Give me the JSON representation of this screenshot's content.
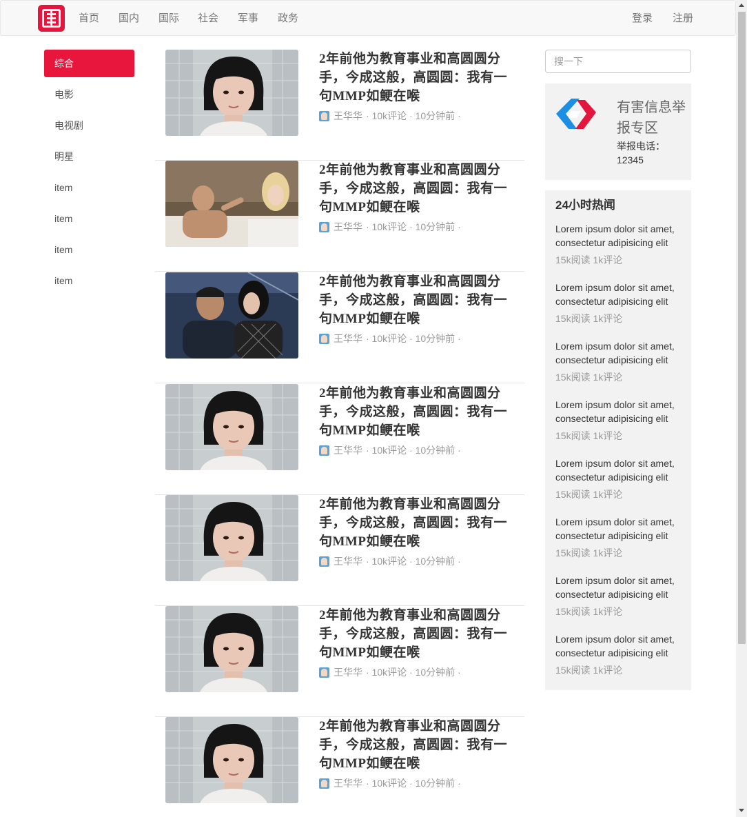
{
  "navbar": {
    "brand": "挂",
    "items": [
      "首页",
      "国内",
      "国际",
      "社会",
      "军事",
      "政务"
    ],
    "login": "登录",
    "register": "注册"
  },
  "sidebar": {
    "items": [
      {
        "label": "综合",
        "active": true
      },
      {
        "label": "电影"
      },
      {
        "label": "电视剧"
      },
      {
        "label": "明星"
      },
      {
        "label": "item"
      },
      {
        "label": "item"
      },
      {
        "label": "item"
      },
      {
        "label": "item"
      }
    ]
  },
  "articles": [
    {
      "title": "2年前他为教育事业和高圆圆分手，今成这般，高圆圆：我有一句MMP如鲠在喉",
      "author": "王华华",
      "meta": "· 10k评论 · 10分钟前 ·",
      "image": "girl-portrait"
    },
    {
      "title": "2年前他为教育事业和高圆圆分手，今成这般，高圆圆：我有一句MMP如鲠在喉",
      "author": "王华华",
      "meta": "· 10k评论 · 10分钟前 ·",
      "image": "bed-scene"
    },
    {
      "title": "2年前他为教育事业和高圆圆分手，今成这般，高圆圆：我有一句MMP如鲠在喉",
      "author": "王华华",
      "meta": "· 10k评论 · 10分钟前 ·",
      "image": "couple-car"
    },
    {
      "title": "2年前他为教育事业和高圆圆分手，今成这般，高圆圆：我有一句MMP如鲠在喉",
      "author": "王华华",
      "meta": "· 10k评论 · 10分钟前 ·",
      "image": "girl-portrait"
    },
    {
      "title": "2年前他为教育事业和高圆圆分手，今成这般，高圆圆：我有一句MMP如鲠在喉",
      "author": "王华华",
      "meta": "· 10k评论 · 10分钟前 ·",
      "image": "girl-portrait"
    },
    {
      "title": "2年前他为教育事业和高圆圆分手，今成这般，高圆圆：我有一句MMP如鲠在喉",
      "author": "王华华",
      "meta": "· 10k评论 · 10分钟前 ·",
      "image": "girl-portrait"
    },
    {
      "title": "2年前他为教育事业和高圆圆分手，今成这般，高圆圆：我有一句MMP如鲠在喉",
      "author": "王华华",
      "meta": "· 10k评论 · 10分钟前 ·",
      "image": "girl-portrait"
    }
  ],
  "search": {
    "placeholder": "搜一下"
  },
  "report": {
    "title": "有害信息举报专区",
    "phone": "举报电话：12345"
  },
  "hot": {
    "title": "24小时热闻",
    "items": [
      {
        "text": "Lorem ipsum dolor sit amet, consectetur adipisicing elit",
        "stats": "15k阅读 1k评论"
      },
      {
        "text": "Lorem ipsum dolor sit amet, consectetur adipisicing elit",
        "stats": "15k阅读 1k评论"
      },
      {
        "text": "Lorem ipsum dolor sit amet, consectetur adipisicing elit",
        "stats": "15k阅读 1k评论"
      },
      {
        "text": "Lorem ipsum dolor sit amet, consectetur adipisicing elit",
        "stats": "15k阅读 1k评论"
      },
      {
        "text": "Lorem ipsum dolor sit amet, consectetur adipisicing elit",
        "stats": "15k阅读 1k评论"
      },
      {
        "text": "Lorem ipsum dolor sit amet, consectetur adipisicing elit",
        "stats": "15k阅读 1k评论"
      },
      {
        "text": "Lorem ipsum dolor sit amet, consectetur adipisicing elit",
        "stats": "15k阅读 1k评论"
      },
      {
        "text": "Lorem ipsum dolor sit amet, consectetur adipisicing elit",
        "stats": "15k阅读 1k评论"
      }
    ]
  },
  "colors": {
    "accent": "#e8153d",
    "panel": "#f2f2f2",
    "navbar": "#f8f8f8"
  }
}
